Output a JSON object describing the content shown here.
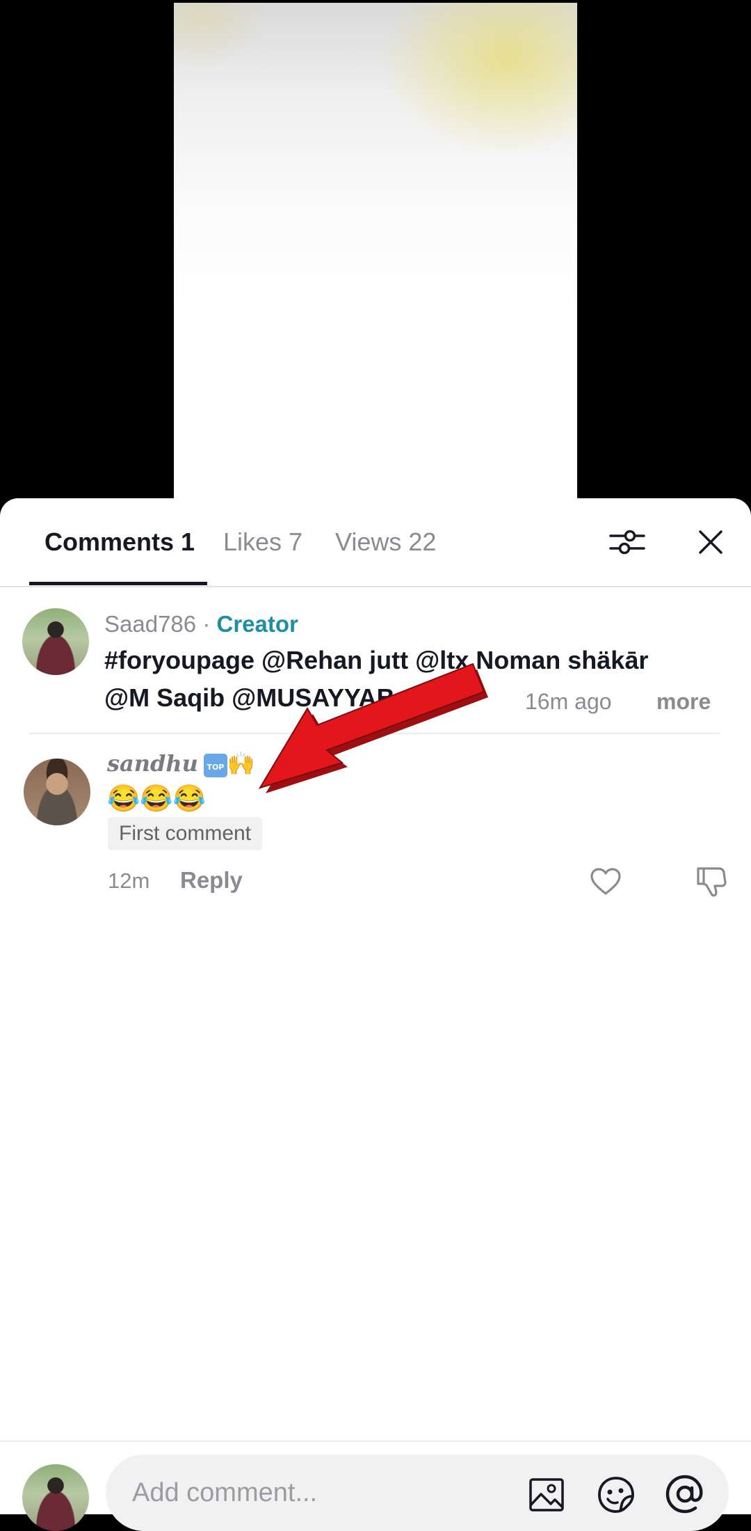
{
  "tabs": [
    {
      "label": "Comments",
      "count": "1"
    },
    {
      "label": "Likes",
      "count": "7"
    },
    {
      "label": "Views",
      "count": "22"
    }
  ],
  "header_icons": {
    "filter": "sliders-icon",
    "close": "close-icon"
  },
  "creator_comment": {
    "username": "Saad786",
    "separator": "·",
    "role": "Creator",
    "line1": "#foryoupage @Rehan jutt @ltx  Noman shäkār",
    "line2": "@M Saqib @MUSAYYAB",
    "line2_faded": "r.l",
    "ellipsis": "...",
    "time": "16m ago",
    "more": "more"
  },
  "comment": {
    "username": "sandhu",
    "badge": "TOP",
    "name_emoji": "🙌",
    "text": "😂😂😂",
    "tag": "First comment",
    "time": "12m",
    "reply": "Reply"
  },
  "input": {
    "placeholder": "Add comment..."
  },
  "colors": {
    "creator_accent": "#1c8fa5",
    "arrow": "#e3161b"
  }
}
